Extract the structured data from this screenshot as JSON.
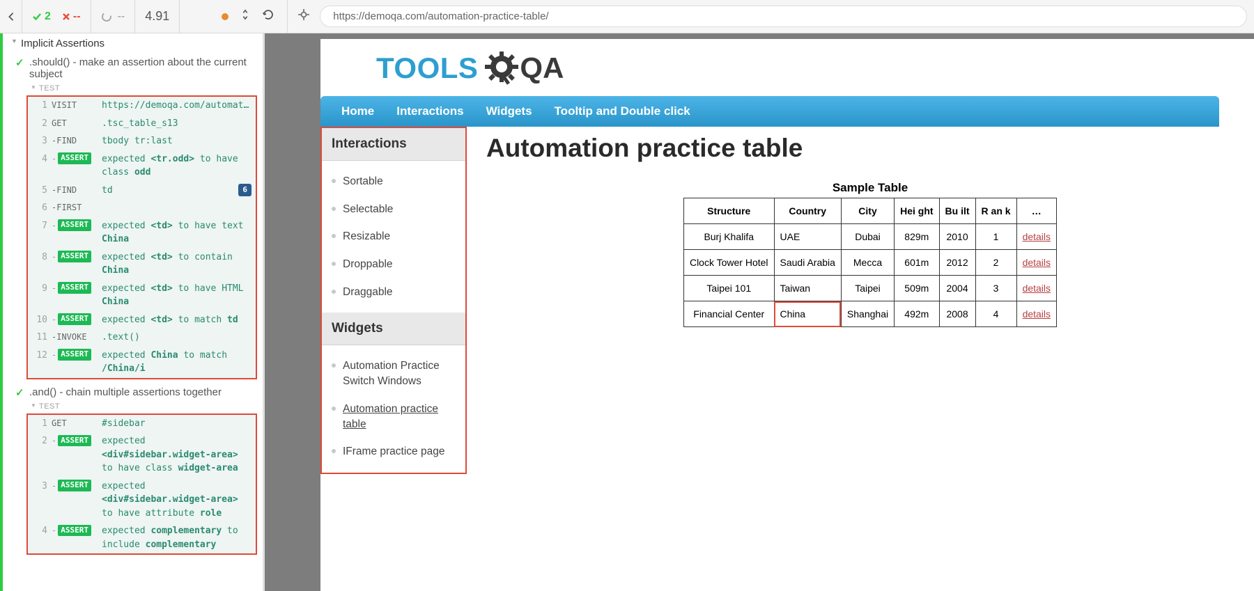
{
  "toolbar": {
    "pass_count": "2",
    "fail_count": "--",
    "pending": "--",
    "time": "4.91",
    "url": "https://demoqa.com/automation-practice-table/"
  },
  "suites": [
    {
      "title": "Implicit Assertions",
      "tests": [
        {
          "title": ".should() - make an assertion about the current subject",
          "test_label": "TEST",
          "steps": [
            {
              "n": "1",
              "cmd": "VISIT",
              "plain": true,
              "msg": "https://demoqa.com/automat…"
            },
            {
              "n": "2",
              "cmd": "GET",
              "plain": true,
              "msg": ".tsc_table_s13"
            },
            {
              "n": "3",
              "cmd": "-FIND",
              "plain": true,
              "msg": "tbody tr:last"
            },
            {
              "n": "4",
              "cmd": "ASSERT",
              "assert": true,
              "parts": [
                "expected ",
                "<tr.odd>",
                " to have class ",
                "odd"
              ]
            },
            {
              "n": "5",
              "cmd": "-FIND",
              "plain": true,
              "msg": "td",
              "badge": "6"
            },
            {
              "n": "6",
              "cmd": "-FIRST",
              "plain": true,
              "msg": ""
            },
            {
              "n": "7",
              "cmd": "ASSERT",
              "assert": true,
              "parts": [
                "expected ",
                "<td>",
                " to have text ",
                "China"
              ]
            },
            {
              "n": "8",
              "cmd": "ASSERT",
              "assert": true,
              "parts": [
                "expected ",
                "<td>",
                " to contain ",
                "China"
              ]
            },
            {
              "n": "9",
              "cmd": "ASSERT",
              "assert": true,
              "parts": [
                "expected ",
                "<td>",
                " to have HTML ",
                "China"
              ]
            },
            {
              "n": "10",
              "cmd": "ASSERT",
              "assert": true,
              "parts": [
                "expected ",
                "<td>",
                " to match ",
                "td"
              ]
            },
            {
              "n": "11",
              "cmd": "-INVOKE",
              "plain": true,
              "msg": ".text()"
            },
            {
              "n": "12",
              "cmd": "ASSERT",
              "assert": true,
              "parts": [
                "expected ",
                "China",
                " to match ",
                "/China/i"
              ]
            }
          ]
        },
        {
          "title": ".and() - chain multiple assertions together",
          "test_label": "TEST",
          "steps": [
            {
              "n": "1",
              "cmd": "GET",
              "plain": true,
              "msg": "#sidebar"
            },
            {
              "n": "2",
              "cmd": "ASSERT",
              "assert": true,
              "parts": [
                "expected ",
                "<div#sidebar.widget-area>",
                " to have class ",
                "widget-area"
              ]
            },
            {
              "n": "3",
              "cmd": "ASSERT",
              "assert": true,
              "parts": [
                "expected ",
                "<div#sidebar.widget-area>",
                " to have attribute ",
                "role"
              ]
            },
            {
              "n": "4",
              "cmd": "ASSERT",
              "assert": true,
              "parts": [
                "expected ",
                "complementary",
                " to include ",
                "complementary"
              ]
            }
          ]
        }
      ]
    }
  ],
  "aut": {
    "logo_tools": "TOOLS",
    "logo_qa": "QA",
    "nav": [
      "Home",
      "Interactions",
      "Widgets",
      "Tooltip and Double click"
    ],
    "sidebar": [
      {
        "heading": "Interactions",
        "items": [
          "Sortable",
          "Selectable",
          "Resizable",
          "Droppable",
          "Draggable"
        ]
      },
      {
        "heading": "Widgets",
        "items": [
          "Automation Practice Switch Windows",
          "Automation practice table",
          "IFrame practice page"
        ]
      }
    ],
    "page_title": "Automation practice table",
    "table": {
      "caption": "Sample Table",
      "headers": [
        "Structure",
        "Country",
        "City",
        "Height",
        "Built",
        "Rank",
        "…"
      ],
      "headers_display": [
        "Structure",
        "Country",
        "City",
        "Hei ght",
        "Bu ilt",
        "R an k",
        "…"
      ],
      "rows": [
        {
          "cells": [
            "Burj Khalifa",
            "UAE",
            "Dubai",
            "829m",
            "2010",
            "1"
          ],
          "link": "details"
        },
        {
          "cells": [
            "Clock Tower Hotel",
            "Saudi Arabia",
            "Mecca",
            "601m",
            "2012",
            "2"
          ],
          "link": "details"
        },
        {
          "cells": [
            "Taipei 101",
            "Taiwan",
            "Taipei",
            "509m",
            "2004",
            "3"
          ],
          "link": "details"
        },
        {
          "cells": [
            "Financial Center",
            "China",
            "Shanghai",
            "492m",
            "2008",
            "4"
          ],
          "link": "details",
          "highlight_country": true
        }
      ]
    }
  }
}
